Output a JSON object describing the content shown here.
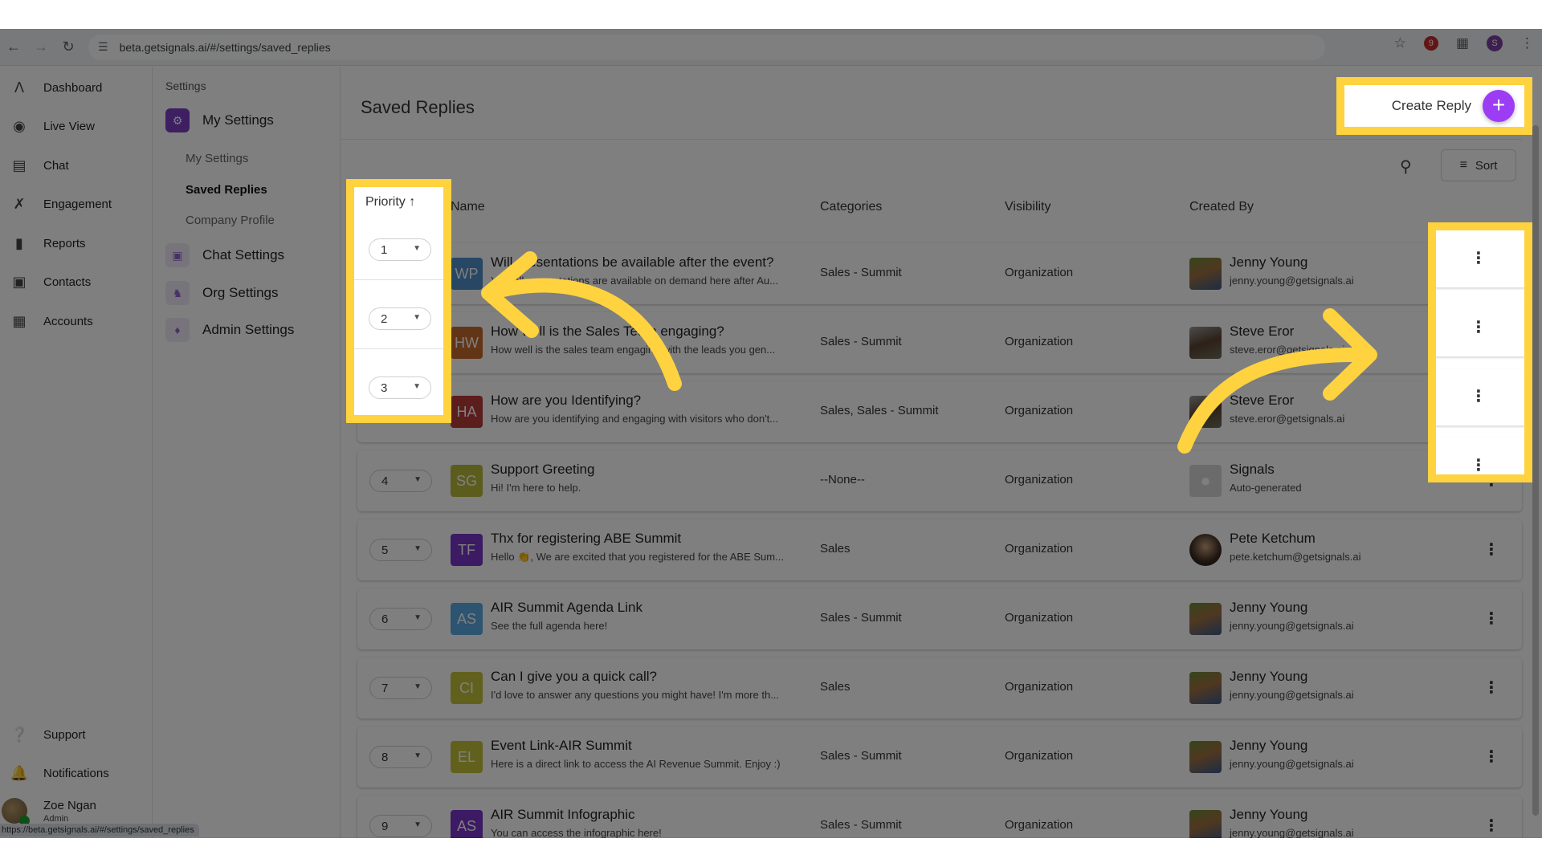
{
  "browser": {
    "url": "beta.getsignals.ai/#/settings/saved_replies",
    "status_url": "https://beta.getsignals.ai/#/settings/saved_replies",
    "profile_initial": "S",
    "extension_badge": "9"
  },
  "leftnav": {
    "items": [
      {
        "label": "Dashboard",
        "icon": "logo-icon"
      },
      {
        "label": "Live View",
        "icon": "live-view-icon"
      },
      {
        "label": "Chat",
        "icon": "chat-icon"
      },
      {
        "label": "Engagement",
        "icon": "engagement-icon"
      },
      {
        "label": "Reports",
        "icon": "reports-icon"
      },
      {
        "label": "Contacts",
        "icon": "contacts-icon"
      },
      {
        "label": "Accounts",
        "icon": "accounts-icon"
      }
    ],
    "bottom": [
      {
        "label": "Support",
        "icon": "help-icon"
      },
      {
        "label": "Notifications",
        "icon": "bell-icon"
      }
    ],
    "user": {
      "name": "Zoe Ngan",
      "role": "Admin"
    }
  },
  "settings_nav": {
    "title": "Settings",
    "groups": [
      {
        "label": "My Settings",
        "active": true
      },
      {
        "label": "Chat Settings",
        "active": false
      },
      {
        "label": "Org Settings",
        "active": false
      },
      {
        "label": "Admin Settings",
        "active": false
      }
    ],
    "sub_items": [
      {
        "label": "My Settings",
        "selected": false
      },
      {
        "label": "Saved Replies",
        "selected": true
      },
      {
        "label": "Company Profile",
        "selected": false
      }
    ]
  },
  "main": {
    "title": "Saved Replies",
    "create_label": "Create Reply",
    "sort_label": "Sort",
    "columns": {
      "priority": "Priority",
      "name": "Name",
      "categories": "Categories",
      "visibility": "Visibility",
      "created_by": "Created By"
    },
    "rows": [
      {
        "priority": "1",
        "initials": "WP",
        "color": "#4f8fc9",
        "name": "Will presentations be available after the event?",
        "desc": "Yes, all presentations are available on demand here after Au...",
        "categories": "Sales - Summit",
        "visibility": "Organization",
        "creator": "Jenny Young",
        "email": "jenny.young@getsignals.ai",
        "avatar": "photo-jenny"
      },
      {
        "priority": "2",
        "initials": "HW",
        "color": "#c46a2e",
        "name": "How well is the Sales Team engaging?",
        "desc": "How well is the sales team engaging with the leads you gen...",
        "categories": "Sales - Summit",
        "visibility": "Organization",
        "creator": "Steve Eror",
        "email": "steve.eror@getsignals.ai",
        "avatar": "photo-steve"
      },
      {
        "priority": "3",
        "initials": "HA",
        "color": "#b83a3a",
        "name": "How are you Identifying?",
        "desc": "How are you identifying and engaging with visitors who don't...",
        "categories": "Sales, Sales - Summit",
        "visibility": "Organization",
        "creator": "Steve Eror",
        "email": "steve.eror@getsignals.ai",
        "avatar": "photo-steve"
      },
      {
        "priority": "4",
        "initials": "SG",
        "color": "#b9b83a",
        "name": "Support Greeting",
        "desc": "Hi! I'm here to help.",
        "categories": "--None--",
        "visibility": "Organization",
        "creator": "Signals",
        "email": "Auto-generated",
        "avatar": "placeholder"
      },
      {
        "priority": "5",
        "initials": "TF",
        "color": "#7a35c8",
        "name": "Thx for registering ABE Summit",
        "desc": "Hello 👏, We are excited that you registered for the ABE Sum...",
        "categories": "Sales",
        "visibility": "Organization",
        "creator": "Pete Ketchum",
        "email": "pete.ketchum@getsignals.ai",
        "avatar": "photo-pete"
      },
      {
        "priority": "6",
        "initials": "AS",
        "color": "#5aa9e0",
        "name": "AIR Summit Agenda Link",
        "desc": "See the full agenda here!",
        "categories": "Sales - Summit",
        "visibility": "Organization",
        "creator": "Jenny Young",
        "email": "jenny.young@getsignals.ai",
        "avatar": "photo-jenny"
      },
      {
        "priority": "7",
        "initials": "CI",
        "color": "#c2c23a",
        "name": "Can I give you a quick call?",
        "desc": "I'd love to answer any questions you might have! I'm more th...",
        "categories": "Sales",
        "visibility": "Organization",
        "creator": "Jenny Young",
        "email": "jenny.young@getsignals.ai",
        "avatar": "photo-jenny"
      },
      {
        "priority": "8",
        "initials": "EL",
        "color": "#c2c23a",
        "name": "Event Link-AIR Summit",
        "desc": "Here is a direct link to access the AI Revenue Summit. Enjoy :)",
        "categories": "Sales - Summit",
        "visibility": "Organization",
        "creator": "Jenny Young",
        "email": "jenny.young@getsignals.ai",
        "avatar": "photo-jenny"
      },
      {
        "priority": "9",
        "initials": "AS",
        "color": "#7a35c8",
        "name": "AIR Summit Infographic",
        "desc": "You can access the infographic here!",
        "categories": "Sales - Summit",
        "visibility": "Organization",
        "creator": "Jenny Young",
        "email": "jenny.young@getsignals.ai",
        "avatar": "photo-jenny"
      }
    ]
  },
  "annotation": {
    "highlight_color": "#ffd23f",
    "accent_color": "#9c3cf5"
  }
}
